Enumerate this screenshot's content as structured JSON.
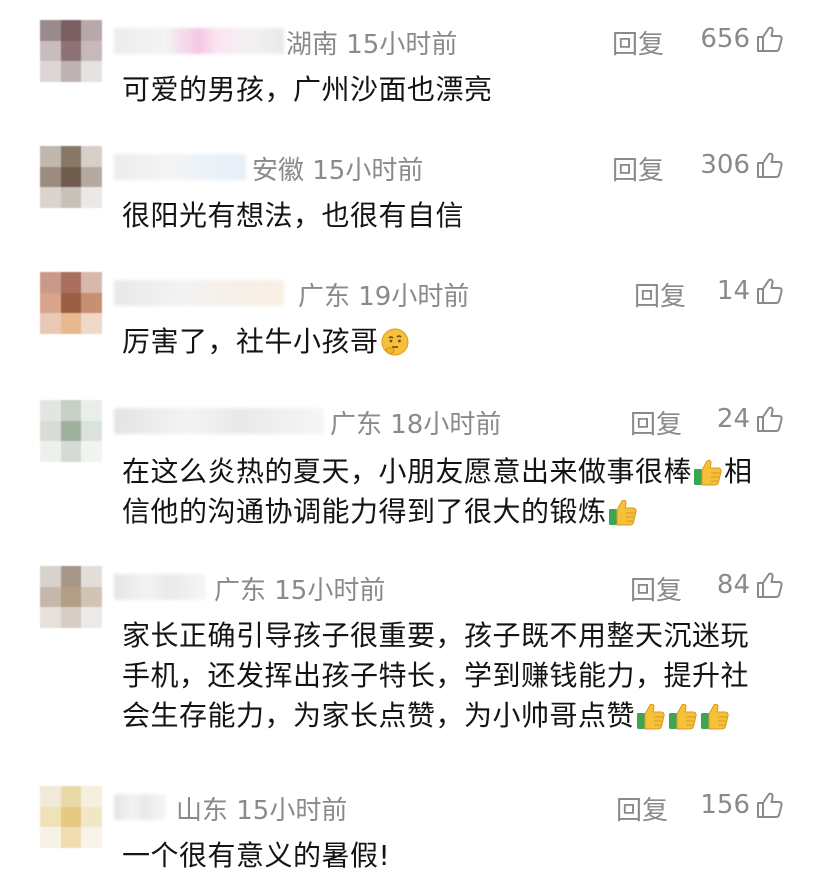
{
  "comments": [
    {
      "location_time": "湖南 15小时前",
      "reply_label": "回复",
      "likes": "656",
      "lines": [
        "可爱的男孩，广州沙面也漂亮"
      ]
    },
    {
      "location_time": "安徽 15小时前",
      "reply_label": "回复",
      "likes": "306",
      "lines": [
        "很阳光有想法，也很有自信"
      ]
    },
    {
      "location_time": "广东 19小时前",
      "reply_label": "回复",
      "likes": "14",
      "lines": [
        "厉害了，社牛小孩哥"
      ]
    },
    {
      "location_time": "广东 18小时前",
      "reply_label": "回复",
      "likes": "24",
      "lines": [
        "在这么炎热的夏天，小朋友愿意出来做事很棒",
        "相",
        "信他的沟通协调能力得到了很大的锻炼"
      ]
    },
    {
      "location_time": "广东 15小时前",
      "reply_label": "回复",
      "likes": "84",
      "lines": [
        "家长正确引导孩子很重要，孩子既不用整天沉迷玩",
        "手机，还发挥出孩子特长，学到赚钱能力，提升社",
        "会生存能力，为家长点赞，为小帅哥点赞"
      ]
    },
    {
      "location_time": "山东 15小时前",
      "reply_label": "回复",
      "likes": "156",
      "lines": [
        "一个很有意义的暑假!"
      ]
    }
  ],
  "icons": {
    "like": "thumbs-up-outline-icon",
    "emoji_thinking": "thinking-face-emoji",
    "emoji_thumbs": "thumbs-up-emoji"
  },
  "colors": {
    "meta_text": "#8a8a8a",
    "body_text": "#141414",
    "emoji_yellow": "#f7c03a",
    "emoji_cuff": "#3aa655"
  }
}
